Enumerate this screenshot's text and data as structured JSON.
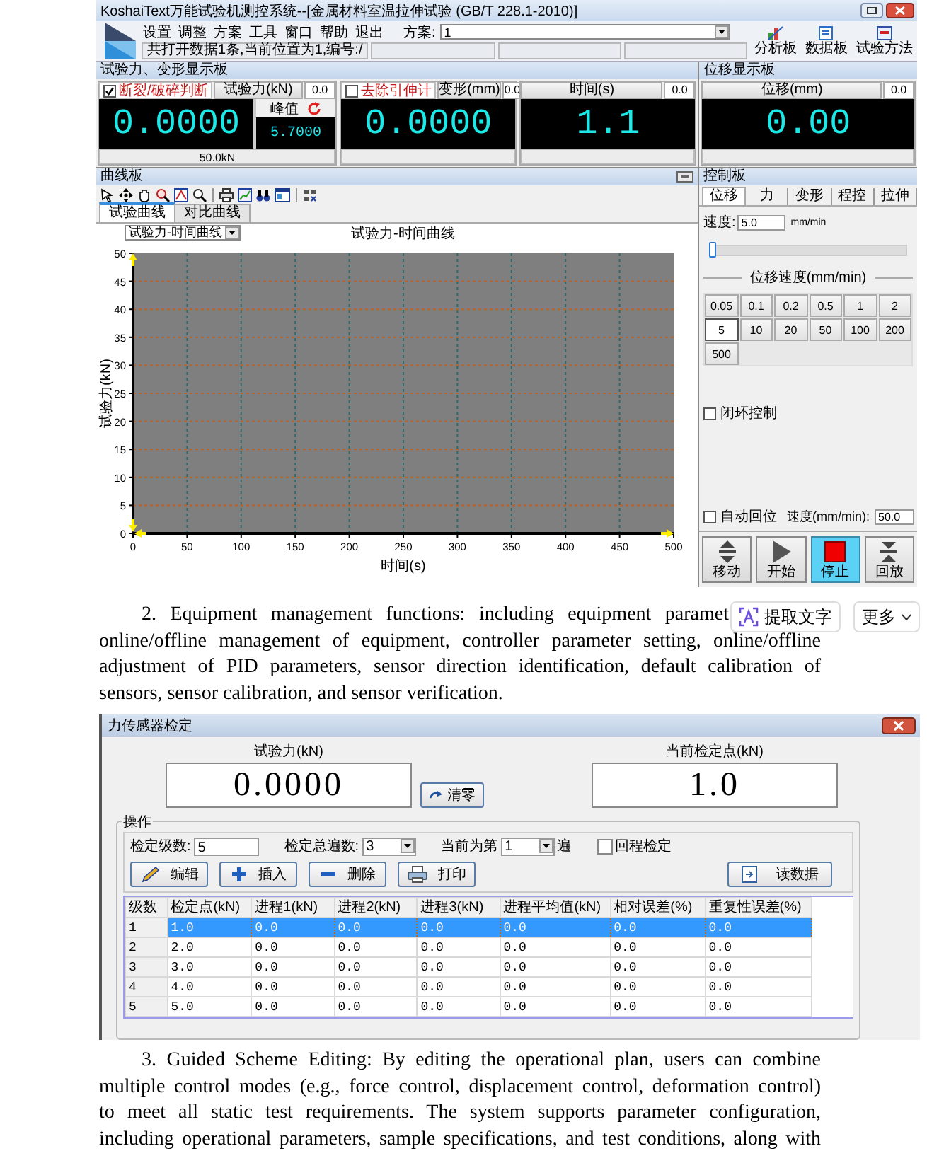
{
  "app": {
    "title": "KoshaiText万能试验机测控系统--[金属材料室温拉伸试验 (GB/T 228.1-2010)]",
    "menu": [
      "设置",
      "调整",
      "方案",
      "工具",
      "窗口",
      "帮助",
      "退出"
    ],
    "scheme": {
      "label": "方案:",
      "value": "1"
    },
    "status": "共打开数据1条,当前位置为1,编号:/",
    "tools": [
      {
        "label": "分析板",
        "kind": "analysis"
      },
      {
        "label": "数据板",
        "kind": "data"
      },
      {
        "label": "试验方法",
        "kind": "method"
      }
    ],
    "display_panels": [
      {
        "title": "试验力、变形显示板",
        "displays": [
          {
            "kind": "force",
            "checkbox": {
              "label": "断裂/破碎判断",
              "checked": true
            },
            "header": "试验力(kN)",
            "zero": "0.0",
            "value": "0.0000",
            "peak_label": "峰值",
            "peak_value": "5.7000",
            "footer": "50.0kN"
          },
          {
            "kind": "plain",
            "checkbox": {
              "label": "去除引伸计",
              "checked": false
            },
            "header": "变形(mm)",
            "zero": "0.0",
            "value": "0.0000"
          },
          {
            "kind": "plain",
            "header": "时间(s)",
            "zero": "0.0",
            "value": "1.1"
          }
        ]
      },
      {
        "title": "位移显示板",
        "displays": [
          {
            "kind": "plain",
            "header": "位移(mm)",
            "zero": "0.0",
            "value": "0.00"
          }
        ]
      }
    ],
    "curve_panel": {
      "title": "曲线板",
      "tabs": [
        {
          "label": "试验曲线",
          "selected": true
        },
        {
          "label": "对比曲线",
          "selected": false
        }
      ],
      "curve_select": "试验力-时间曲线",
      "chart_data": {
        "type": "line",
        "grid": true,
        "title": "试验力-时间曲线",
        "xlabel": "时间(s)",
        "ylabel": "试验力(kN)",
        "xlim": [
          0,
          500
        ],
        "ylim": [
          0,
          50
        ],
        "xticks": [
          0,
          50,
          100,
          150,
          200,
          250,
          300,
          350,
          400,
          450,
          500
        ],
        "yticks": [
          0,
          5,
          10,
          15,
          20,
          25,
          30,
          35,
          40,
          45,
          50
        ]
      }
    },
    "control_panel": {
      "title": "控制板",
      "tabs": [
        {
          "label": "位移",
          "selected": true
        },
        {
          "label": "力",
          "selected": false
        },
        {
          "label": "变形",
          "selected": false
        },
        {
          "label": "程控",
          "selected": false
        },
        {
          "label": "拉伸",
          "selected": false
        }
      ],
      "speed_label": "速度:",
      "speed_value": "5.0",
      "speed_unit": "mm/min",
      "slider": {
        "level": 0
      },
      "speed_heading": "位移速度(mm/min)",
      "speed_buttons": [
        {
          "label": "0.05",
          "selected": false
        },
        {
          "label": "0.1",
          "selected": false
        },
        {
          "label": "0.2",
          "selected": false
        },
        {
          "label": "0.5",
          "selected": false
        },
        {
          "label": "1",
          "selected": false
        },
        {
          "label": "2",
          "selected": false
        },
        {
          "label": "5",
          "selected": true
        },
        {
          "label": "10",
          "selected": false
        },
        {
          "label": "20",
          "selected": false
        },
        {
          "label": "50",
          "selected": false
        },
        {
          "label": "100",
          "selected": false
        },
        {
          "label": "200",
          "selected": false
        },
        {
          "label": "500",
          "selected": false
        }
      ],
      "closed_loop": {
        "label": "闭环控制",
        "checked": false
      },
      "auto_return": {
        "label": "自动回位",
        "checked": false
      },
      "return_speed_label": "速度(mm/min):",
      "return_speed_value": "50.0",
      "actions": [
        {
          "label": "移动",
          "kind": "move",
          "selected": false
        },
        {
          "label": "开始",
          "kind": "start",
          "selected": false
        },
        {
          "label": "停止",
          "kind": "stop",
          "selected": true
        },
        {
          "label": "回放",
          "kind": "return",
          "selected": false
        }
      ]
    }
  },
  "paragraph_2": {
    "first_line": "2. Equipment management functions: including equipment paramet",
    "rest": "online/offline management of equipment, controller parameter setting, online/offline adjustment of PID parameters, sensor direction identification, default calibration of sensors, sensor calibration, and sensor verification."
  },
  "text_toolbar": {
    "extract": "提取文字",
    "more": "更多"
  },
  "sensor_dialog": {
    "title": "力传感器检定",
    "force": {
      "label": "试验力(kN)",
      "value": "0.0000"
    },
    "zero_button": "清零",
    "point": {
      "label": "当前检定点(kN)",
      "value": "1.0"
    },
    "group": {
      "title": "操作",
      "levels_label": "检定级数:",
      "levels_value": "5",
      "passes_label": "检定总遍数:",
      "passes_value": "3",
      "current_label": "当前为第",
      "current_value": "1",
      "current_suffix": "遍",
      "return_check": {
        "label": "回程检定",
        "checked": false
      },
      "buttons": [
        {
          "label": "编辑",
          "kind": "edit"
        },
        {
          "label": "插入",
          "kind": "insert"
        },
        {
          "label": "删除",
          "kind": "delete"
        },
        {
          "label": "打印",
          "kind": "print"
        },
        {
          "label": "读数据",
          "kind": "read"
        }
      ]
    },
    "table": {
      "columns": [
        "级数",
        "检定点(kN)",
        "进程1(kN)",
        "进程2(kN)",
        "进程3(kN)",
        "进程平均值(kN)",
        "相对误差(%)",
        "重复性误差(%)"
      ],
      "rows": [
        {
          "cells": [
            "1",
            "1.0",
            "0.0",
            "0.0",
            "0.0",
            "0.0",
            "0.0",
            "0.0"
          ],
          "selected": true
        },
        {
          "cells": [
            "2",
            "2.0",
            "0.0",
            "0.0",
            "0.0",
            "0.0",
            "0.0",
            "0.0"
          ],
          "selected": false
        },
        {
          "cells": [
            "3",
            "3.0",
            "0.0",
            "0.0",
            "0.0",
            "0.0",
            "0.0",
            "0.0"
          ],
          "selected": false
        },
        {
          "cells": [
            "4",
            "4.0",
            "0.0",
            "0.0",
            "0.0",
            "0.0",
            "0.0",
            "0.0"
          ],
          "selected": false
        },
        {
          "cells": [
            "5",
            "5.0",
            "0.0",
            "0.0",
            "0.0",
            "0.0",
            "0.0",
            "0.0"
          ],
          "selected": false
        }
      ]
    }
  },
  "paragraph_3": "3. Guided Scheme Editing: By editing the operational plan, users can combine multiple control modes (e.g., force control, displacement control, deformation control) to meet all static test requirements. The system supports parameter configuration, including operational parameters, sample specifications, and test conditions, along with"
}
